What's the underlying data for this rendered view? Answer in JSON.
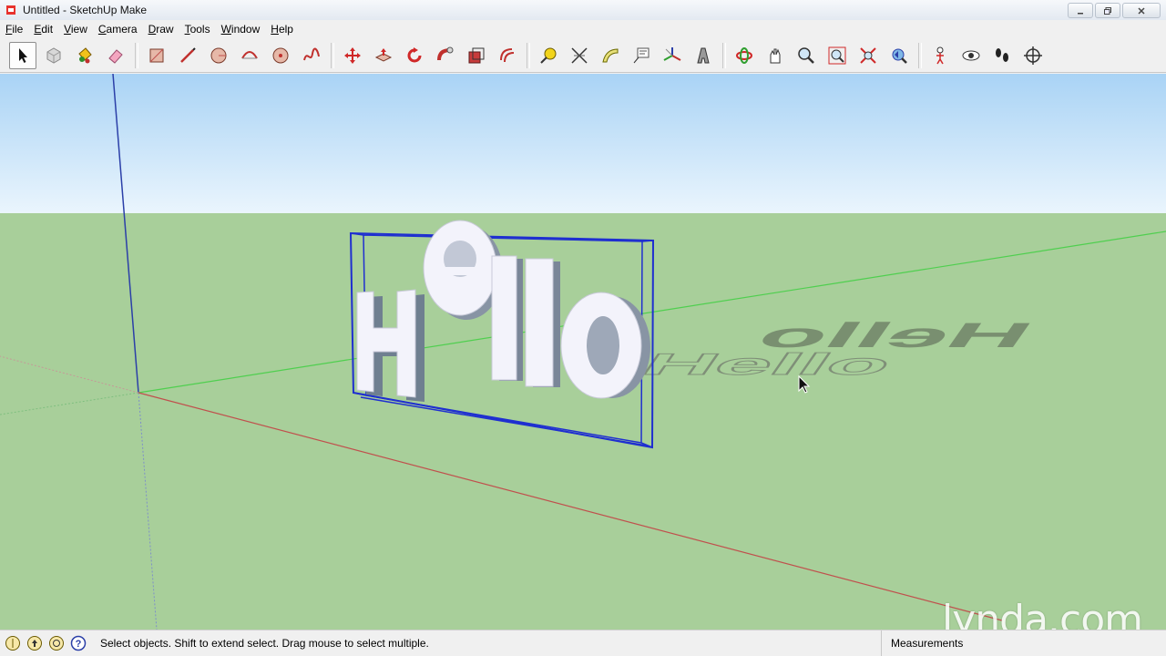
{
  "window": {
    "title": "Untitled - SketchUp Make",
    "buttons": [
      "minimize",
      "maximize",
      "close"
    ]
  },
  "menubar": {
    "items": [
      {
        "label": "File"
      },
      {
        "label": "Edit"
      },
      {
        "label": "View"
      },
      {
        "label": "Camera"
      },
      {
        "label": "Draw"
      },
      {
        "label": "Tools"
      },
      {
        "label": "Window"
      },
      {
        "label": "Help"
      }
    ]
  },
  "toolbar": {
    "groups": [
      [
        "select-icon",
        "make-component-icon",
        "paint-bucket-icon",
        "eraser-icon"
      ],
      [
        "rectangle-icon",
        "line-icon",
        "circle-icon",
        "arc-icon",
        "polygon-icon",
        "freehand-icon"
      ],
      [
        "move-icon",
        "push-pull-icon",
        "rotate-icon",
        "follow-me-icon",
        "scale-icon",
        "offset-icon"
      ],
      [
        "tape-measure-icon",
        "dimension-icon",
        "protractor-icon",
        "text-icon",
        "axes-icon",
        "3d-text-icon"
      ],
      [
        "orbit-icon",
        "pan-icon",
        "zoom-icon",
        "zoom-window-icon",
        "zoom-extents-icon",
        "previous-view-icon"
      ],
      [
        "position-camera-icon",
        "look-around-icon",
        "walk-icon",
        "section-plane-icon"
      ]
    ],
    "active": "select-icon"
  },
  "viewport": {
    "sky_color_top": "#a9d3f5",
    "sky_color_bottom": "#eaf5fd",
    "ground_color": "#a8cf9a",
    "text_object": "Hello",
    "selection_color": "#1f2fd0",
    "axis_red": "#c0504d",
    "axis_green": "#4fcf4f",
    "axis_blue": "#2b3fa8"
  },
  "statusbar": {
    "icons": [
      "geo-location-icon",
      "credits-icon",
      "user-icon",
      "help-icon"
    ],
    "message": "Select objects. Shift to extend select. Drag mouse to select multiple.",
    "measurements_label": "Measurements"
  },
  "watermark": {
    "text": "lynda.com"
  }
}
